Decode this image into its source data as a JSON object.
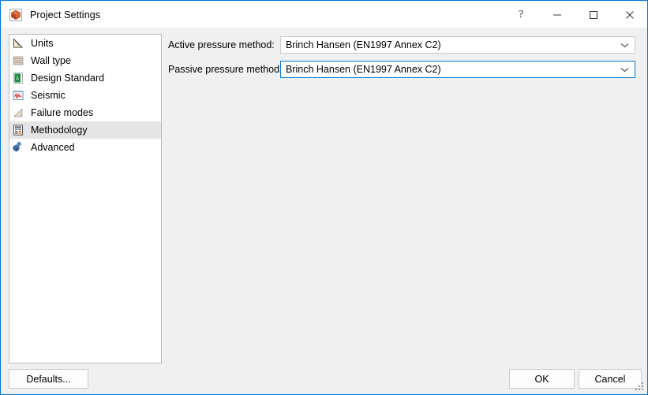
{
  "window": {
    "title": "Project Settings",
    "icon": "app-cube-icon",
    "accent_color": "#0078d7",
    "body_color": "#f0f0f0",
    "titlebar_color": "#ffffff",
    "controls": [
      {
        "name": "help",
        "glyph": "?"
      },
      {
        "name": "minimize",
        "glyph": "—"
      },
      {
        "name": "maximize",
        "glyph": "□"
      },
      {
        "name": "close",
        "glyph": "×"
      }
    ]
  },
  "sidebar": {
    "items": [
      {
        "label": "Units",
        "icon": "set-square-icon",
        "selected": false
      },
      {
        "label": "Wall type",
        "icon": "brick-wall-icon",
        "selected": false
      },
      {
        "label": "Design Standard",
        "icon": "lambda-doc-icon",
        "selected": false
      },
      {
        "label": "Seismic",
        "icon": "seismograph-icon",
        "selected": false
      },
      {
        "label": "Failure modes",
        "icon": "soil-wedge-icon",
        "selected": false
      },
      {
        "label": "Methodology",
        "icon": "table-grid-icon",
        "selected": true
      },
      {
        "label": "Advanced",
        "icon": "gears-icon",
        "selected": false
      }
    ],
    "selected_color": "#e5e5e5"
  },
  "main": {
    "fields": [
      {
        "label": "Active pressure method:",
        "value": "Brinch Hansen (EN1997 Annex C2)",
        "focused": false
      },
      {
        "label": "Passive pressure method:",
        "value": "Brinch Hansen (EN1997 Annex C2)",
        "focused": true
      }
    ]
  },
  "footer": {
    "defaults_label": "Defaults...",
    "ok_label": "OK",
    "cancel_label": "Cancel"
  }
}
